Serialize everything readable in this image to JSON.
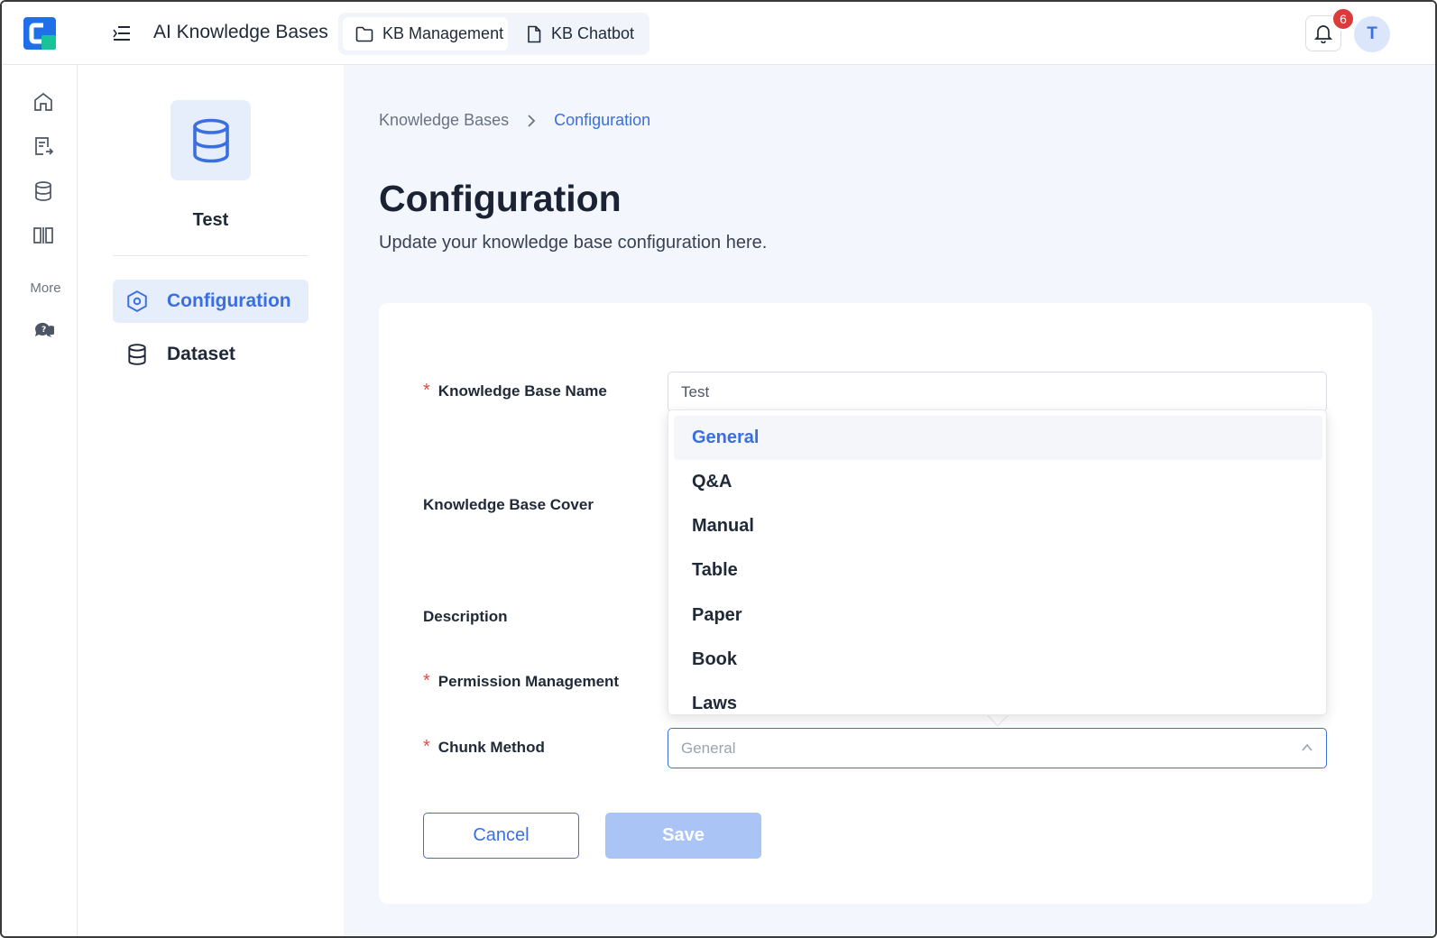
{
  "app": {
    "title": "AI Knowledge Bases"
  },
  "tabs": [
    {
      "label": "KB Management",
      "icon": "folder-icon"
    },
    {
      "label": "KB Chatbot",
      "icon": "file-icon"
    }
  ],
  "header": {
    "notification_count": "6",
    "avatar_initial": "T"
  },
  "rail": {
    "more_label": "More"
  },
  "sidebar": {
    "kb_name": "Test",
    "items": [
      {
        "label": "Configuration",
        "icon": "gear-hex-icon"
      },
      {
        "label": "Dataset",
        "icon": "database-icon"
      }
    ]
  },
  "breadcrumb": {
    "root": "Knowledge Bases",
    "current": "Configuration"
  },
  "page": {
    "title": "Configuration",
    "subtitle": "Update your knowledge base configuration here."
  },
  "form": {
    "name_label": "Knowledge Base Name",
    "name_value": "Test",
    "cover_label": "Knowledge Base Cover",
    "description_label": "Description",
    "permission_label": "Permission Management",
    "chunk_label": "Chunk Method",
    "chunk_value": "General",
    "required_mark": "*",
    "cancel_label": "Cancel",
    "save_label": "Save"
  },
  "dropdown": {
    "options": [
      "General",
      "Q&A",
      "Manual",
      "Table",
      "Paper",
      "Book",
      "Laws"
    ],
    "selected": "General"
  },
  "colors": {
    "accent": "#3b6fe0",
    "badge": "#dc3b3b",
    "main_bg": "#f3f6fc"
  }
}
